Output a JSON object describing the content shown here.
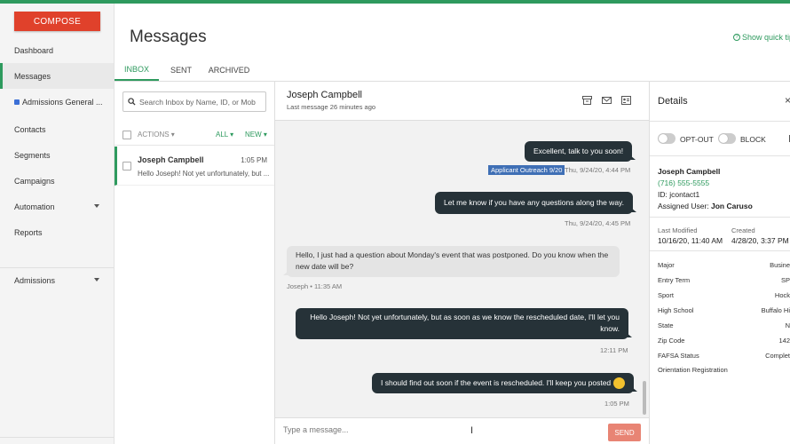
{
  "nav": {
    "compose_label": "COMPOSE",
    "items": [
      {
        "label": "Dashboard"
      },
      {
        "label": "Messages"
      },
      {
        "label": "Admissions General ..."
      },
      {
        "label": "Contacts"
      },
      {
        "label": "Segments"
      },
      {
        "label": "Campaigns"
      },
      {
        "label": "Automation"
      },
      {
        "label": "Reports"
      },
      {
        "label": "Admissions"
      }
    ]
  },
  "header": {
    "title": "Messages",
    "quick_tips": "Show quick tips",
    "tabs": [
      {
        "label": "INBOX",
        "active": true
      },
      {
        "label": "SENT",
        "active": false
      },
      {
        "label": "ARCHIVED",
        "active": false
      }
    ]
  },
  "inbox": {
    "search_placeholder": "Search Inbox by Name, ID, or Mob",
    "actions_label": "ACTIONS",
    "all_label": "ALL",
    "new_label": "NEW",
    "conversations": [
      {
        "name": "Joseph Campbell",
        "time": "1:05 PM",
        "preview": "Hello Joseph! Not yet unfortunately, but ..."
      }
    ]
  },
  "chat": {
    "contact_name": "Joseph Campbell",
    "last_message": "Last message 26 minutes ago",
    "messages": [
      {
        "direction": "out",
        "text": "Excellent, talk to you soon!",
        "tag": "Applicant Outreach 9/20",
        "meta": "Thu, 9/24/20, 4:44 PM"
      },
      {
        "direction": "out",
        "text": "Let me know if you have any questions along the way.",
        "meta": "Thu, 9/24/20, 4:45 PM"
      },
      {
        "direction": "in",
        "text_line1": "Hello, I just had a question about Monday's event that was postponed. Do you know when the",
        "text_line2": "new date will be?",
        "meta": "Joseph • 11:35 AM"
      },
      {
        "direction": "out",
        "text_line1": "Hello Joseph! Not yet unfortunately, but as soon as we know the rescheduled date, I'll let you",
        "text_line2": "know.",
        "meta": "12:11 PM"
      },
      {
        "direction": "out",
        "text": "I should find out soon if the event is rescheduled. I'll keep you posted",
        "meta": "1:05 PM"
      }
    ],
    "input_placeholder": "Type a message...",
    "send_label": "SEND"
  },
  "details": {
    "title": "Details",
    "close": "×",
    "opt_out_label": "OPT-OUT",
    "block_label": "BLOCK",
    "name": "Joseph Campbell",
    "phone": "(716) 555-5555",
    "id_label": "ID:",
    "id_value": "jcontact1",
    "assigned_label": "Assigned User:",
    "assigned_value": "Jon Caruso",
    "last_modified_label": "Last Modified",
    "last_modified_value": "10/16/20, 11:40 AM",
    "created_label": "Created",
    "created_value": "4/28/20, 3:37 PM",
    "attributes": [
      {
        "label": "Major",
        "value": "Busine"
      },
      {
        "label": "Entry Term",
        "value": "SP"
      },
      {
        "label": "Sport",
        "value": "Hock"
      },
      {
        "label": "High School",
        "value": "Buffalo Hi"
      },
      {
        "label": "State",
        "value": "N"
      },
      {
        "label": "Zip Code",
        "value": "142"
      },
      {
        "label": "FAFSA Status",
        "value": "Complet"
      },
      {
        "label": "Orientation Registration",
        "value": ""
      }
    ]
  },
  "colors": {
    "accent": "#2e9a5e",
    "compose": "#e0412b",
    "bubble_out": "#263238",
    "tag": "#3f6fb5",
    "send": "#e88474"
  }
}
